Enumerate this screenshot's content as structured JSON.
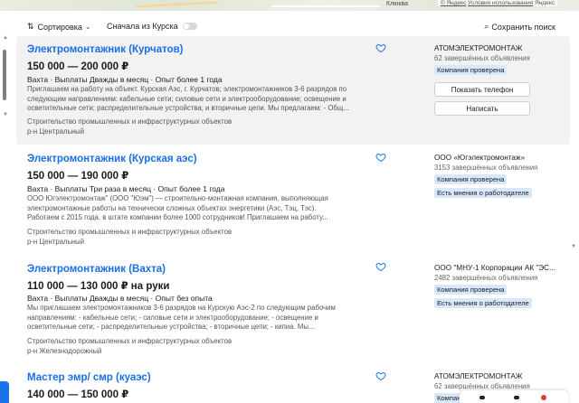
{
  "map": {
    "place_label": "Клюква",
    "attribution_brand": "© Яндекс",
    "attribution_link": "Условия использования",
    "attribution_tail": "Яндекс"
  },
  "toolbar": {
    "sort_label": "Сортировка",
    "kursk_label": "Сначала из Курска",
    "save_search_label": "Сохранить поиск"
  },
  "vacancies": [
    {
      "title": "Электромонтажник (Курчатов)",
      "salary": "150 000 — 200 000 ₽",
      "meta": "Вахта · Выплаты Дважды в месяц · Опыт более 1 года",
      "desc_lines": [
        "Приглашаем на работу на объект. Курская Аэс, г. Курчатов; электромонтажников 3-6 разрядов по",
        "следующим направлениям: кабельные сети; силовые сети и электрооборудование; освещение и",
        "осветительные сети; распределительные устройства; и вторичные цепи. Мы предлагаем: - Общ..."
      ],
      "industry": "Строительство промышленных и инфраструктурных объектов",
      "district": "р-н Центральный",
      "company": "АТОМЭЛЕКТРОМОНТАЖ",
      "company_count": "62 завершённых объявления",
      "badges": [
        "Компания проверена"
      ],
      "buttons": [
        "Показать телефон",
        "Написать"
      ]
    },
    {
      "title": "Электромонтажник (Курская аэс)",
      "salary": "150 000 — 190 000 ₽",
      "meta": "Вахта · Выплаты Три раза в месяц · Опыт более 1 года",
      "desc_lines": [
        "ООО Югэлектромонтаж\" (ООО \"Юэм\") — строительно-монтажная компания, выполняющая",
        "электромонтажные работы на технически сложных объектах энергетики (Аэс, Тэц, Тэс).",
        "Работаем с 2015 года, в штате компании более 1000 сотрудников! Приглашаем на работу..."
      ],
      "industry": "Строительство промышленных и инфраструктурных объектов",
      "district": "р-н Центральный",
      "company": "ООО «Югэлектромонтаж»",
      "company_count": "3153 завершённых объявления",
      "badges": [
        "Компания проверена",
        "Есть мнения о работодателе"
      ],
      "buttons": []
    },
    {
      "title": "Электромонтажник (Вахта)",
      "salary": "110 000 — 130 000 ₽ на руки",
      "meta": "Вахта · Выплаты Дважды в месяц · Опыт без опыта",
      "desc_lines": [
        "Мы приглашаем электромонтажников 3-6 разрядов на Курскую Аэс-2 по следующим рабочим",
        "направлениям: - кабельные сети; - силовые сети и электрооборудование; - освещение и",
        "осветительные сети; - распределительные устройства; - вторичные цепи; - кипиа. Мы..."
      ],
      "industry": "Строительство промышленных и инфраструктурных объектов",
      "district": "р-н Железнодорожный",
      "company": "ООО \"МНУ-1 Корпорации АК \"ЭС...",
      "company_count": "2482 завершённых объявления",
      "badges": [
        "Компания проверена",
        "Есть мнения о работодателе"
      ],
      "buttons": []
    },
    {
      "title": "Мастер эмр/ смр (куаэс)",
      "salary": "140 000 — 150 000 ₽",
      "meta": "",
      "desc_lines": [],
      "industry": "",
      "district": "",
      "company": "АТОМЭЛЕКТРОМОНТАЖ",
      "company_count": "62 завершённых объявления",
      "badges": [
        "Компания проверена"
      ],
      "buttons": []
    }
  ],
  "colors": {
    "link_blue": "#1a6fe8",
    "badge_bg": "#d8e8fb",
    "highlight_bg": "#f2f2f2"
  }
}
